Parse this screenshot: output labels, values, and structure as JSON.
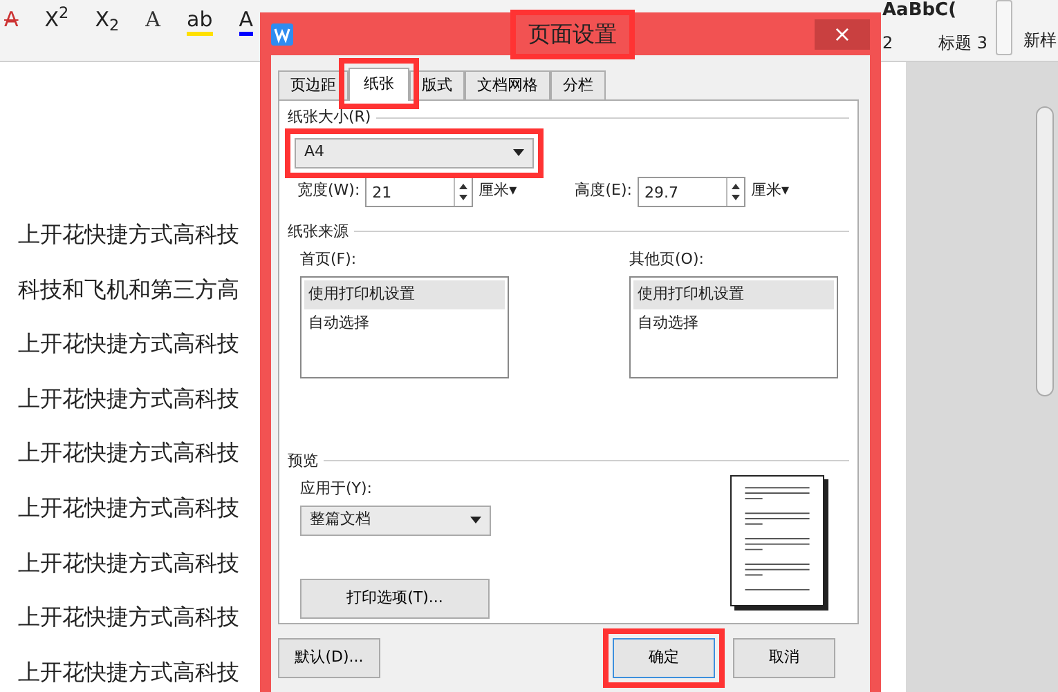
{
  "ribbon": {
    "tools": [
      {
        "kind": "strike",
        "text": "A"
      },
      {
        "kind": "plain",
        "text": "X$^{2}$"
      },
      {
        "kind": "plain",
        "text": "X$_{2}$"
      },
      {
        "kind": "outline",
        "text": "A"
      },
      {
        "kind": "highlight",
        "text": "ab"
      },
      {
        "kind": "color",
        "text": "A"
      }
    ],
    "style_gallery": {
      "big_preview": "AaBbC(",
      "labels": [
        "2",
        "标题 3"
      ]
    },
    "new_style": "新样"
  },
  "document": {
    "lines": [
      "上开花快捷方式高科技",
      "科技和飞机和第三方高",
      "上开花快捷方式高科技",
      "上开花快捷方式高科技",
      "上开花快捷方式高科技",
      "上开花快捷方式高科技",
      "上开花快捷方式高科技",
      "上开花快捷方式高科技",
      "上开花快捷方式高科技"
    ]
  },
  "dialog": {
    "title": "页面设置",
    "title_highlighted": true,
    "close": "×",
    "tabs": [
      {
        "label": "页边距",
        "selected": false,
        "highlighted": false
      },
      {
        "label": "纸张",
        "selected": true,
        "highlighted": true
      },
      {
        "label": "版式",
        "selected": false,
        "highlighted": false
      },
      {
        "label": "文档网格",
        "selected": false,
        "highlighted": false
      },
      {
        "label": "分栏",
        "selected": false,
        "highlighted": false
      }
    ],
    "paper_size": {
      "label": "纸张大小(R)",
      "value": "A4",
      "highlighted": true
    },
    "width": {
      "label": "宽度(W):",
      "value": "21",
      "unit": "厘米▾"
    },
    "height": {
      "label": "高度(E):",
      "value": "29.7",
      "unit": "厘米▾"
    },
    "paper_source": {
      "label": "纸张来源",
      "lists": [
        {
          "label": "首页(F):",
          "items": [
            {
              "text": "使用打印机设置",
              "selected": true
            },
            {
              "text": "自动选择",
              "selected": false
            }
          ]
        },
        {
          "label": "其他页(O):",
          "items": [
            {
              "text": "使用打印机设置",
              "selected": true
            },
            {
              "text": "自动选择",
              "selected": false
            }
          ]
        }
      ]
    },
    "preview": {
      "label": "预览",
      "apply_label": "应用于(Y):",
      "apply_value": "整篇文档",
      "print_options": "打印选项(T)..."
    },
    "buttons": [
      {
        "label": "默认(D)...",
        "kind": "default",
        "highlighted": false
      },
      {
        "label": "确定",
        "kind": "ok",
        "highlighted": true
      },
      {
        "label": "取消",
        "kind": "cancel",
        "highlighted": false
      }
    ]
  }
}
